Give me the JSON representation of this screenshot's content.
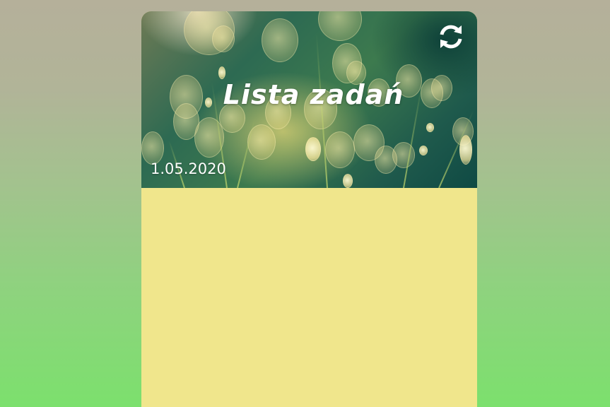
{
  "header": {
    "title": "Lista zadań",
    "date": "1.05.2020",
    "refresh_icon": "refresh-icon"
  },
  "colors": {
    "card_background": "#f0e68c",
    "page_gradient_top": "#b5b09a",
    "page_gradient_bottom": "#7ce06d",
    "header_text": "#ffffff"
  },
  "task_list": {
    "items": []
  }
}
